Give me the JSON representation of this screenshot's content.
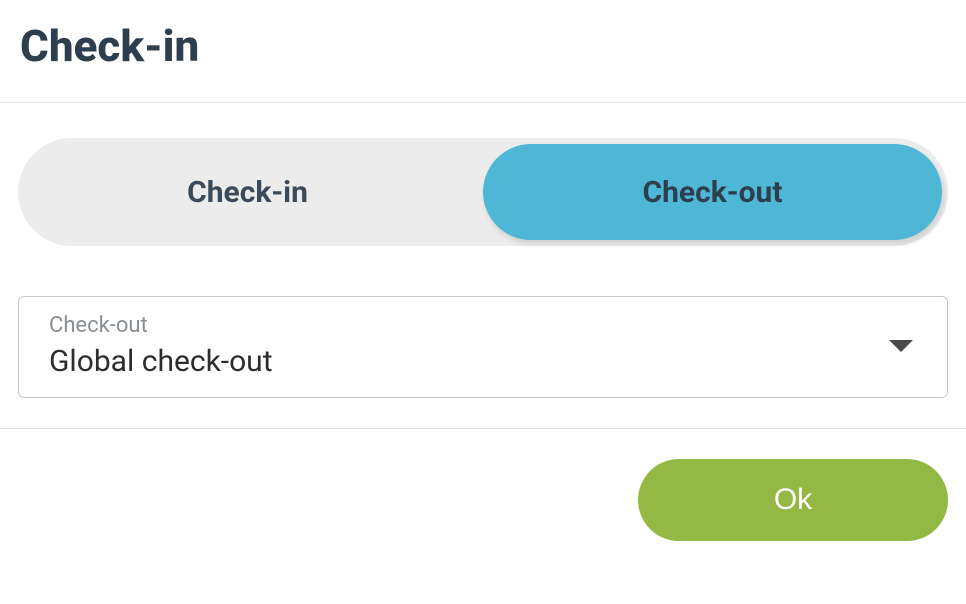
{
  "header": {
    "title": "Check-in"
  },
  "tabs": {
    "items": [
      {
        "label": "Check-in",
        "active": false
      },
      {
        "label": "Check-out",
        "active": true
      }
    ]
  },
  "select": {
    "label": "Check-out",
    "value": "Global check-out"
  },
  "footer": {
    "ok_label": "Ok"
  }
}
